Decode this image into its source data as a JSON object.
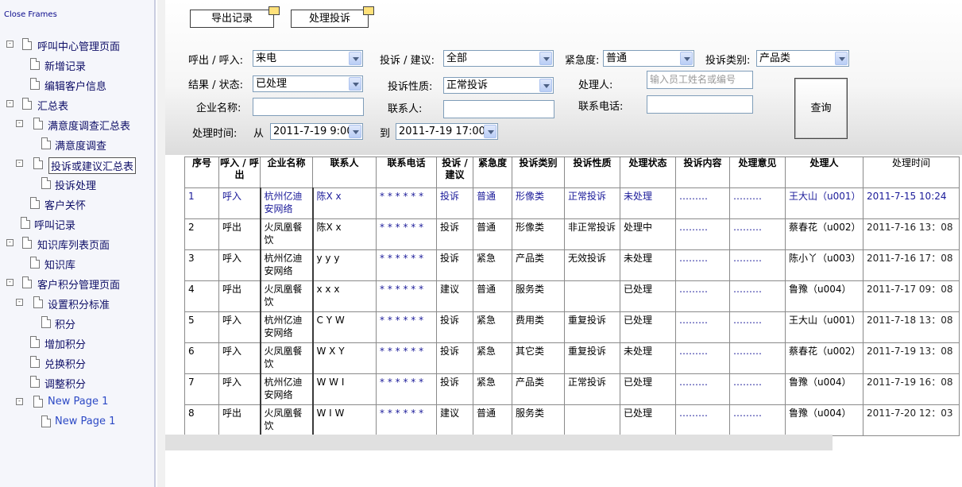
{
  "nav": {
    "close_frames": "Close Frames",
    "items": [
      {
        "label": "呼叫中心管理页面",
        "toggle": "-"
      },
      {
        "label": "新增记录"
      },
      {
        "label": "编辑客户信息"
      },
      {
        "label": "汇总表",
        "toggle": "-"
      },
      {
        "label": "满意度调查汇总表",
        "toggle": "-"
      },
      {
        "label": "满意度调查"
      },
      {
        "label": "投诉或建议汇总表",
        "toggle": "-"
      },
      {
        "label": "投诉处理"
      },
      {
        "label": "客户关怀"
      },
      {
        "label": "呼叫记录"
      },
      {
        "label": "知识库列表页面",
        "toggle": "-"
      },
      {
        "label": "知识库"
      },
      {
        "label": "客户积分管理页面",
        "toggle": "-"
      },
      {
        "label": "设置积分标准",
        "toggle": "-"
      },
      {
        "label": "积分"
      },
      {
        "label": "增加积分"
      },
      {
        "label": "兑换积分"
      },
      {
        "label": "调整积分"
      },
      {
        "label": "New Page 1",
        "toggle": "-"
      },
      {
        "label": "New Page 1"
      }
    ]
  },
  "toolbar": {
    "export_label": "导出记录",
    "handle_label": "处理投诉"
  },
  "filters": {
    "call_label": "呼出 / 呼入:",
    "call_value": "来电",
    "type_label": "投诉 / 建议:",
    "type_value": "全部",
    "urgency_label": "紧急度:",
    "urgency_value": "普通",
    "category_label": "投诉类别:",
    "category_value": "产品类",
    "result_label": "结果 / 状态:",
    "result_value": "已处理",
    "nature_label": "投诉性质:",
    "nature_value": "正常投诉",
    "handler_label": "处理人:",
    "handler_placeholder": "输入员工姓名或编号",
    "company_label": "企业名称:",
    "contact_label": "联系人:",
    "phone_label": "联系电话:",
    "time_label": "处理时间:",
    "from_label": "从",
    "from_value": "2011-7-19 9:00",
    "to_label": "到",
    "to_value": "2011-7-19 17:00",
    "query_label": "查询"
  },
  "table": {
    "headers": [
      "序号",
      "呼入 / 呼出",
      "企业名称",
      "联系人",
      "联系电话",
      "投诉 / 建议",
      "紧急度",
      "投诉类别",
      "投诉性质",
      "处理状态",
      "投诉内容",
      "处理意见",
      "处理人",
      "处理时间"
    ],
    "rows": [
      {
        "no": "1",
        "call": "呼入",
        "company": "杭州亿迪安网络",
        "contact": "陈X x",
        "phone": "* * * * * *",
        "type": "投诉",
        "urgency": "普通",
        "category": "形像类",
        "nature": "正常投诉",
        "status": "未处理",
        "content": "………",
        "opinion": "………",
        "handler": "王大山（u001）",
        "time": "2011-7-15 10:24"
      },
      {
        "no": "2",
        "call": "呼出",
        "company": "火凤凰餐饮",
        "contact": "陈X x",
        "phone": "* * * * * *",
        "type": "投诉",
        "urgency": "普通",
        "category": "形像类",
        "nature": "非正常投诉",
        "status": "处理中",
        "content": "………",
        "opinion": "………",
        "handler": "蔡春花（u002）",
        "time": "2011-7-16 13：08"
      },
      {
        "no": "3",
        "call": "呼入",
        "company": "杭州亿迪安网络",
        "contact": "y y y",
        "phone": "* * * * * *",
        "type": "投诉",
        "urgency": "紧急",
        "category": "产品类",
        "nature": "无效投诉",
        "status": "未处理",
        "content": "………",
        "opinion": "………",
        "handler": "陈小丫（u003）",
        "time": "2011-7-16 17：08"
      },
      {
        "no": "4",
        "call": "呼出",
        "company": "火凤凰餐饮",
        "contact": "x x x",
        "phone": "* * * * * *",
        "type": "建议",
        "urgency": "普通",
        "category": "服务类",
        "nature": "",
        "status": "已处理",
        "content": "………",
        "opinion": "………",
        "handler": "鲁豫（u004）",
        "time": "2011-7-17 09：08"
      },
      {
        "no": "5",
        "call": "呼入",
        "company": "杭州亿迪安网络",
        "contact": "C Y W",
        "phone": "* * * * * *",
        "type": "投诉",
        "urgency": "紧急",
        "category": "费用类",
        "nature": "重复投诉",
        "status": "已处理",
        "content": "………",
        "opinion": "………",
        "handler": "王大山（u001）",
        "time": "2011-7-18 13：08"
      },
      {
        "no": "6",
        "call": "呼入",
        "company": "火凤凰餐饮",
        "contact": "W X Y",
        "phone": "* * * * * *",
        "type": "投诉",
        "urgency": "紧急",
        "category": "其它类",
        "nature": "重复投诉",
        "status": "未处理",
        "content": "………",
        "opinion": "………",
        "handler": "蔡春花（u002）",
        "time": "2011-7-19 13：08"
      },
      {
        "no": "7",
        "call": "呼入",
        "company": "杭州亿迪安网络",
        "contact": "W W I",
        "phone": "* * * * * *",
        "type": "投诉",
        "urgency": "紧急",
        "category": "产品类",
        "nature": "正常投诉",
        "status": "已处理",
        "content": "………",
        "opinion": "………",
        "handler": "鲁豫（u004）",
        "time": "2011-7-19 16：08"
      },
      {
        "no": "8",
        "call": "呼出",
        "company": "火凤凰餐饮",
        "contact": "W I W",
        "phone": "* * * * * *",
        "type": "建议",
        "urgency": "普通",
        "category": "服务类",
        "nature": "",
        "status": "已处理",
        "content": "………",
        "opinion": "………",
        "handler": "鲁豫（u004）",
        "time": "2011-7-20 12：03"
      }
    ]
  },
  "colors": {
    "link_blue": "#1a1a99",
    "nav_text": "#0d0d66",
    "time_blue": "#2a2a9c",
    "new_page_blue": "#2c49c5"
  }
}
